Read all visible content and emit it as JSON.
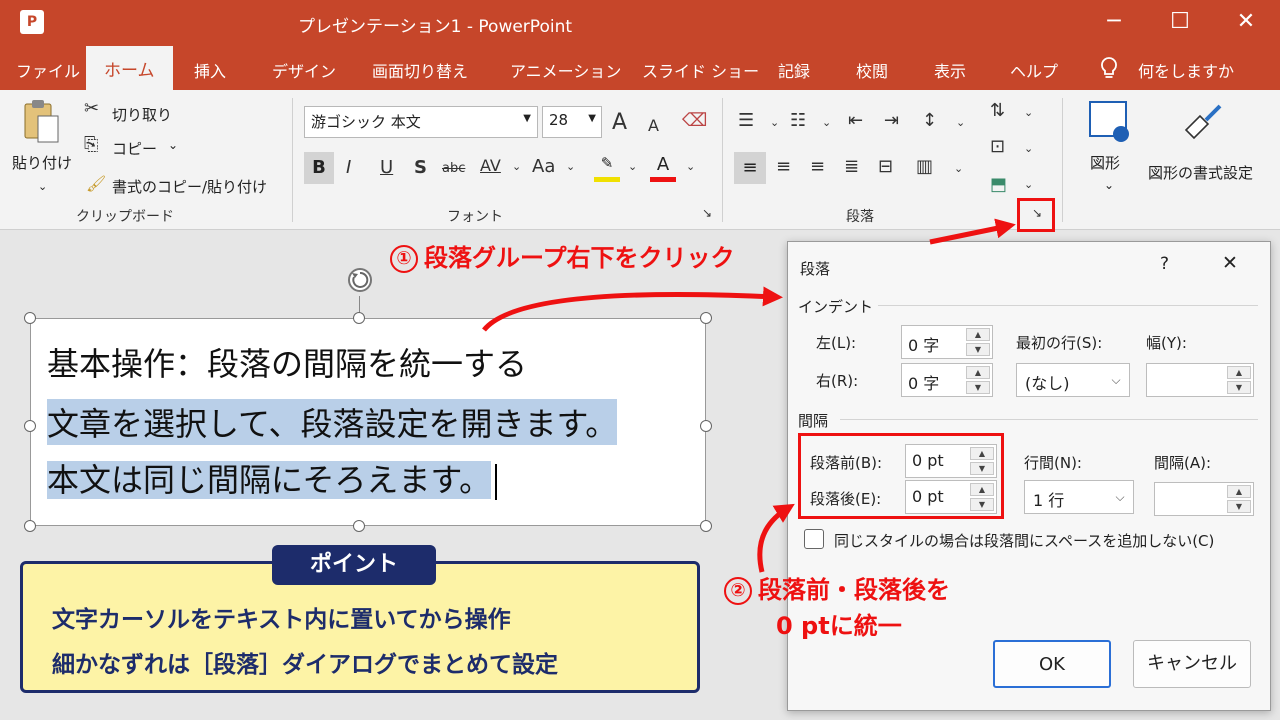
{
  "window": {
    "title": "プレゼンテーション1  -  PowerPoint",
    "app_icon": "P",
    "minimize": "─",
    "maximize": "☐",
    "close": "✕"
  },
  "tabs": [
    "ファイル",
    "ホーム",
    "挿入",
    "デザイン",
    "画面切り替え",
    "アニメーション",
    "スライド ショー",
    "記録",
    "校閲",
    "表示",
    "ヘルプ"
  ],
  "tellme": "何をしますか",
  "ribbon": {
    "clipboard": {
      "paste": "貼り付け",
      "cut": "切り取り",
      "copy": "コピー",
      "format_painter": "書式のコピー/貼り付け",
      "group": "クリップボード"
    },
    "font": {
      "name": "游ゴシック 本文",
      "size": "28",
      "bold": "B",
      "italic": "I",
      "underline": "U",
      "shadow": "S",
      "strike": "abc",
      "spacing": "AV",
      "case": "Aa",
      "grow": "A",
      "shrink": "A",
      "group": "フォント"
    },
    "paragraph": {
      "group": "段落"
    },
    "drawing": {
      "shapes": "図形",
      "shape_format": "図形の書式設定"
    }
  },
  "slide": {
    "line1": "基本操作：段落の間隔を統一する",
    "line2": "文章を選択して、段落設定を開きます。",
    "line3": "本文は同じ間隔にそろえます。"
  },
  "point": {
    "title": "ポイント",
    "line1": "文字カーソルをテキスト内に置いてから操作",
    "line2": "細かなずれは［段落］ダイアログでまとめて設定"
  },
  "callouts": {
    "c1_num": "①",
    "c1": "段落グループ右下をクリック",
    "c2_num": "②",
    "c2_line1": "段落前・段落後を",
    "c2_line2": "0 ptに統一"
  },
  "dialog": {
    "title": "段落",
    "help": "?",
    "close": "✕",
    "indent_section": "インデント",
    "left_label": "左(L):",
    "left_value": "0 字",
    "right_label": "右(R):",
    "right_value": "0 字",
    "first_line_label": "最初の行(S):",
    "first_line_value": "(なし)",
    "width_label": "幅(Y):",
    "spacing_section": "間隔",
    "before_label": "段落前(B):",
    "before_value": "0 pt",
    "after_label": "段落後(E):",
    "after_value": "0 pt",
    "line_spacing_label": "行間(N):",
    "line_spacing_value": "1 行",
    "at_label": "間隔(A):",
    "checkbox_label": "同じスタイルの場合は段落間にスペースを追加しない(C)",
    "ok": "OK",
    "cancel": "キャンセル"
  },
  "colors": {
    "accent": "#c6462a",
    "callout": "#e11111",
    "point_bg": "#fdf3a6",
    "point_border": "#1d2c6b",
    "highlight": "#b9cfe8"
  }
}
